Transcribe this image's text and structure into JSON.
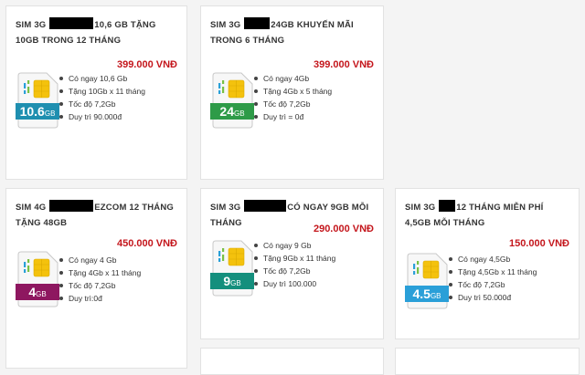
{
  "cards": [
    {
      "title_pre": "SIM 3G",
      "title_post": "10,6 GB TẶNG 10GB TRONG 12 THÁNG",
      "price": "399.000 VNĐ",
      "badge_num": "10.6",
      "badge_unit": "GB",
      "badge_color": "#1f8fb0",
      "features": [
        "Có ngay 10,6 Gb",
        "Tặng 10Gb x 11 tháng",
        "Tốc độ 7,2Gb",
        "Duy trì 90.000đ"
      ]
    },
    {
      "title_pre": "SIM 3G",
      "title_post": "24GB KHUYẾN MÃI TRONG 6 THÁNG",
      "price": "399.000 VNĐ",
      "badge_num": "24",
      "badge_unit": "GB",
      "badge_color": "#2e9b48",
      "features": [
        "Có ngay 4Gb",
        "Tặng 4Gb x 5 tháng",
        "Tốc độ 7,2Gb",
        "Duy trì = 0đ"
      ]
    },
    {
      "title_pre": "SIM 4G",
      "title_post": "EZCOM 12 THÁNG TẶNG 48GB",
      "price": "450.000 VNĐ",
      "badge_num": "4",
      "badge_unit": "GB",
      "badge_color": "#8e1760",
      "features": [
        "Có ngay 4 Gb",
        "Tặng 4Gb x 11 tháng",
        "Tốc độ 7,2Gb",
        "Duy trì:0đ"
      ]
    },
    {
      "title_pre": "SIM 3G",
      "title_post": "CÓ NGAY 9GB MỖI THÁNG",
      "price": "290.000 VNĐ",
      "badge_num": "9",
      "badge_unit": "GB",
      "badge_color": "#148f7d",
      "features": [
        "Có ngay 9 Gb",
        "Tặng 9Gb x 11 tháng",
        "Tốc độ 7,2Gb",
        "Duy trì 100.000"
      ]
    },
    {
      "title_pre": "SIM 3G",
      "title_post": "12 THÁNG MIỄN PHÍ 4,5GB MỖI THÁNG",
      "price": "150.000 VNĐ",
      "badge_num": "4.5",
      "badge_unit": "GB",
      "badge_color": "#2a9fd8",
      "features": [
        "Có ngay 4,5Gb",
        "Tặng 4,5Gb x 11 tháng",
        "Tốc độ 7,2Gb",
        "Duy trì 50.000đ"
      ]
    }
  ]
}
